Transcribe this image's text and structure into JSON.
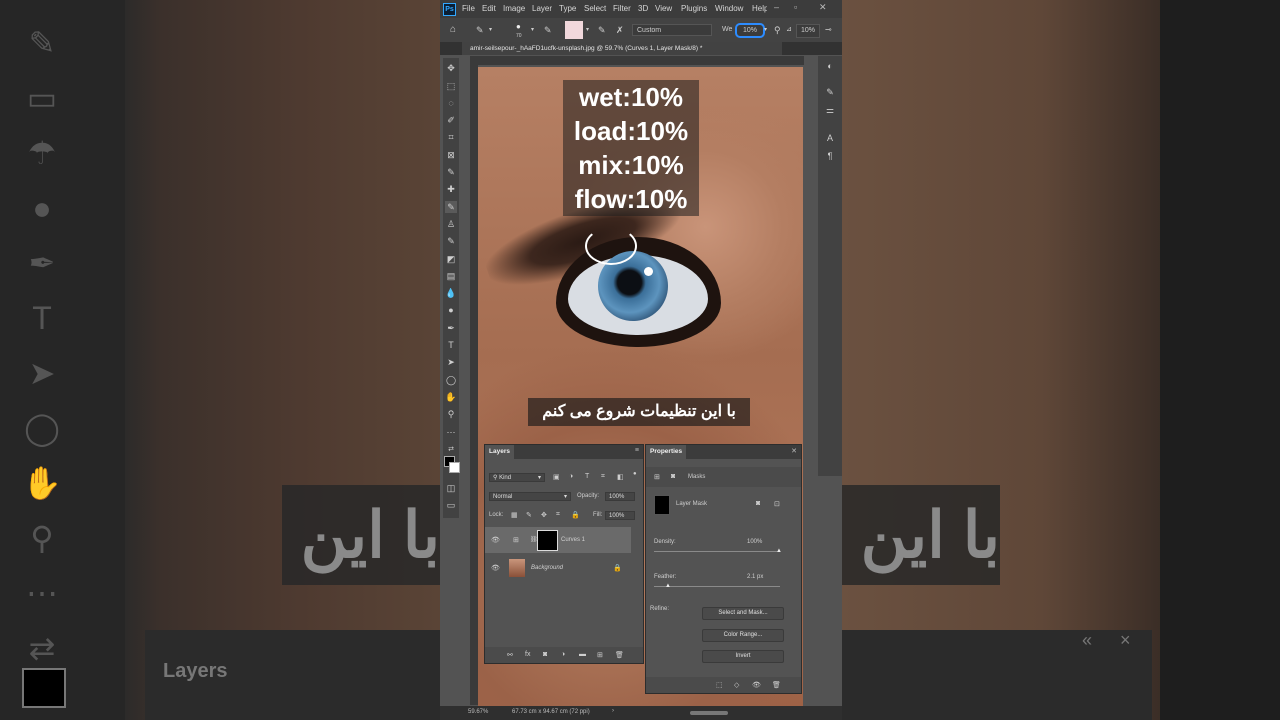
{
  "menubar": {
    "logo": "Ps",
    "items": [
      "File",
      "Edit",
      "Image",
      "Layer",
      "Type",
      "Select",
      "Filter",
      "3D",
      "View",
      "Plugins",
      "Window",
      "Help"
    ]
  },
  "options": {
    "brush_size": "70",
    "preset": "Custom",
    "wet_label": "We",
    "wet_value": "10%",
    "flow_value": "10%"
  },
  "document": {
    "tab_title": "amir-seilsepour-_hAaFD1ucfk-unsplash.jpg @ 59.7% (Curves 1, Layer Mask/8) *",
    "close": "×"
  },
  "overlay": {
    "settings": [
      "wet:10%",
      "load:10%",
      "mix:10%",
      "flow:10%"
    ],
    "subtitle": "با این تنظیمات شروع می کنم"
  },
  "layers_panel": {
    "title": "Layers",
    "kind": "Kind",
    "blend_mode": "Normal",
    "opacity_label": "Opacity:",
    "opacity_value": "100%",
    "lock_label": "Lock:",
    "fill_label": "Fill:",
    "fill_value": "100%",
    "layers": [
      {
        "name": "Curves 1",
        "visible": true
      },
      {
        "name": "Background",
        "visible": true
      }
    ]
  },
  "properties_panel": {
    "title": "Properties",
    "section": "Masks",
    "mask_label": "Layer Mask",
    "density_label": "Density:",
    "density_value": "100%",
    "feather_label": "Feather:",
    "feather_value": "2.1 px",
    "refine_label": "Refine:",
    "select_mask_button": "Select and Mask...",
    "color_range_button": "Color Range...",
    "invert_button": "Invert"
  },
  "statusbar": {
    "zoom": "59.67%",
    "dimensions": "67.73 cm x 94.67 cm (72 ppi)"
  },
  "background": {
    "caption_left": "با این تنظیمات شروع می کنم",
    "caption_right": "با این تن",
    "layers_label": "Layers"
  }
}
